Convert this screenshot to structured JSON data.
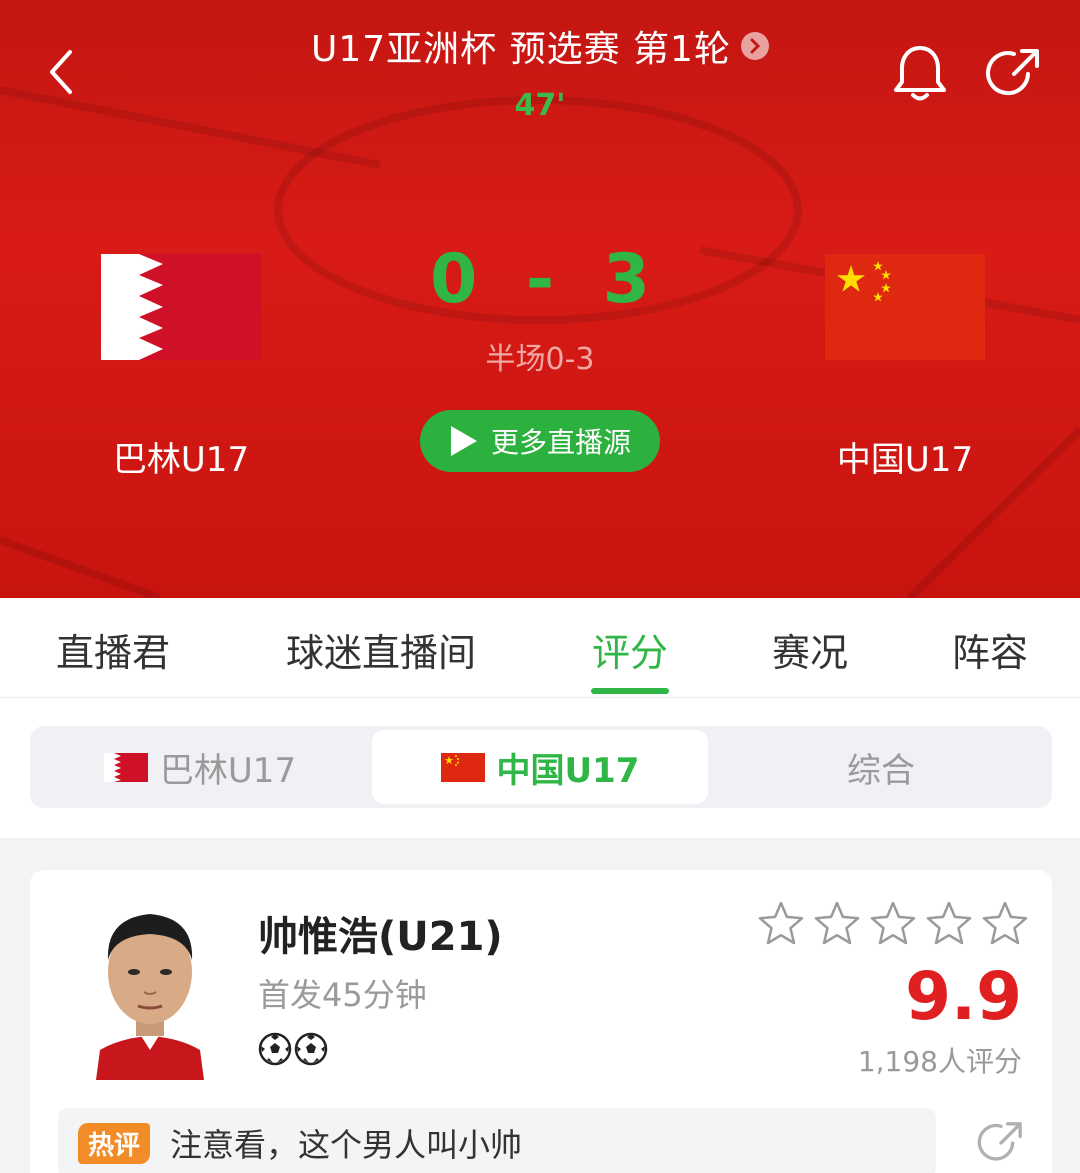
{
  "header": {
    "match_title": "U17亚洲杯 预选赛 第1轮",
    "minute": "47'",
    "home_team": "巴林U17",
    "away_team": "中国U17",
    "home_score": "0",
    "separator": "-",
    "away_score": "3",
    "halftime": "半场0-3",
    "more_live_label": "更多直播源"
  },
  "tabs": [
    {
      "label": "直播君",
      "active": false
    },
    {
      "label": "球迷直播间",
      "active": false
    },
    {
      "label": "评分",
      "active": true
    },
    {
      "label": "赛况",
      "active": false
    },
    {
      "label": "阵容",
      "active": false
    }
  ],
  "team_switch": {
    "options": [
      {
        "label": "巴林U17",
        "active": false
      },
      {
        "label": "中国U17",
        "active": true
      },
      {
        "label": "综合",
        "active": false
      }
    ]
  },
  "player": {
    "name": "帅惟浩(U21)",
    "meta": "首发45分钟",
    "goals": 2,
    "stars_filled": 0,
    "stars_total": 5,
    "rating": "9.9",
    "rating_count": "1,198人评分",
    "hot_badge": "热评",
    "hot_comment": "注意看，这个男人叫小帅"
  },
  "colors": {
    "header_red": "#d81b16",
    "accent_green": "#2fb646",
    "rating_red": "#e02020",
    "hot_orange": "#f28c28"
  },
  "icons": [
    "back-arrow-icon",
    "chevron-right-icon",
    "bell-icon",
    "share-icon",
    "play-icon",
    "bahrain-flag-icon",
    "china-flag-icon",
    "star-icon",
    "football-icon"
  ]
}
